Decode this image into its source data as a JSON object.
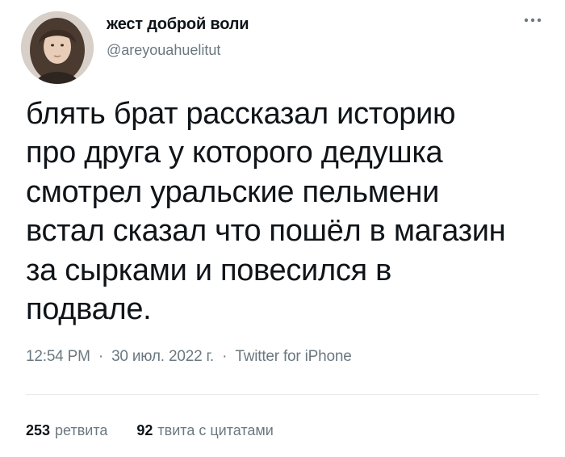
{
  "author": {
    "display_name": "жест доброй воли",
    "handle": "@areyouahuelitut",
    "avatar_icon": "avatar"
  },
  "more_icon": "more-icon",
  "tweet": {
    "text": "блять брат рассказал историю\nпро друга у которого дедушка\nсмотрел уральские пельмени\nвстал сказал что пошёл в магазин\nза сырками и повесился в\nподвале."
  },
  "meta": {
    "time": "12:54 PM",
    "separator": "·",
    "date": "30 июл. 2022 г.",
    "source": "Twitter for iPhone"
  },
  "stats": {
    "retweets": {
      "count": "253",
      "label": "ретвита"
    },
    "quotes": {
      "count": "92",
      "label": "твита с цитатами"
    }
  },
  "colors": {
    "text": "#0f1419",
    "secondary": "#6b7880",
    "divider": "#e6ebee"
  }
}
